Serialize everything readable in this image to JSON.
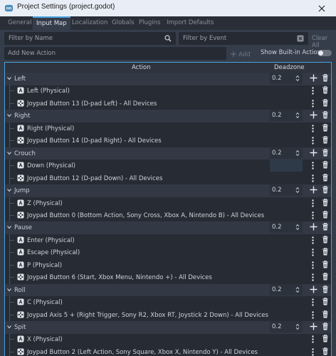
{
  "window": {
    "title": "Project Settings (project.godot)"
  },
  "tabs": [
    {
      "label": "General",
      "active": false
    },
    {
      "label": "Input Map",
      "active": true
    },
    {
      "label": "Localization",
      "active": false
    },
    {
      "label": "Globals",
      "active": false
    },
    {
      "label": "Plugins",
      "active": false
    },
    {
      "label": "Import Defaults",
      "active": false
    }
  ],
  "filters": {
    "by_name_placeholder": "Filter by Name",
    "by_event_placeholder": "Filter by Event",
    "clear_all_label": "Clear All"
  },
  "add_action": {
    "placeholder": "Add New Action",
    "add_label": "Add",
    "show_builtin_label": "Show Built-in Actions",
    "show_builtin_on": false
  },
  "table": {
    "col_action": "Action",
    "col_deadzone": "Deadzone"
  },
  "actions": [
    {
      "name": "Left",
      "deadzone": "0.2",
      "events": [
        {
          "type": "key",
          "label": "Left (Physical)"
        },
        {
          "type": "joy",
          "label": "Joypad Button 13 (D-pad Left) - All Devices"
        }
      ]
    },
    {
      "name": "Right",
      "deadzone": "0.2",
      "events": [
        {
          "type": "key",
          "label": "Right (Physical)"
        },
        {
          "type": "joy",
          "label": "Joypad Button 14 (D-pad Right) - All Devices"
        }
      ]
    },
    {
      "name": "Crouch",
      "deadzone": "0.2",
      "events": [
        {
          "type": "key",
          "label": "Down (Physical)"
        },
        {
          "type": "joy",
          "label": "Joypad Button 12 (D-pad Down) - All Devices"
        }
      ]
    },
    {
      "name": "Jump",
      "deadzone": "0.2",
      "events": [
        {
          "type": "key",
          "label": "Z (Physical)"
        },
        {
          "type": "joy",
          "label": "Joypad Button 0 (Bottom Action, Sony Cross, Xbox A, Nintendo B) - All Devices"
        }
      ]
    },
    {
      "name": "Pause",
      "deadzone": "0.2",
      "events": [
        {
          "type": "key",
          "label": "Enter (Physical)"
        },
        {
          "type": "key",
          "label": "Escape (Physical)"
        },
        {
          "type": "key",
          "label": "P (Physical)"
        },
        {
          "type": "joy",
          "label": "Joypad Button 6 (Start, Xbox Menu, Nintendo +) - All Devices"
        }
      ]
    },
    {
      "name": "Roll",
      "deadzone": "0.2",
      "events": [
        {
          "type": "key",
          "label": "C (Physical)"
        },
        {
          "type": "joy",
          "label": "Joypad Axis 5 + (Right Trigger, Sony R2, Xbox RT, Joystick 2 Down) - All Devices"
        }
      ]
    },
    {
      "name": "Spit",
      "deadzone": "0.2",
      "events": [
        {
          "type": "key",
          "label": "X (Physical)"
        },
        {
          "type": "joy",
          "label": "Joypad Button 2 (Left Action, Sony Square, Xbox X, Nintendo Y) - All Devices"
        }
      ]
    }
  ],
  "colors": {
    "accent": "#4aa3df",
    "background": "#363d4a"
  },
  "icons": {
    "app": "godot-icon",
    "close": "close-icon",
    "search": "search-icon",
    "clear": "clear-icon",
    "add": "plus-icon",
    "remove": "trash-icon",
    "key": "keyboard-icon",
    "joy": "joypad-icon",
    "collapse": "chevron-down-icon"
  }
}
